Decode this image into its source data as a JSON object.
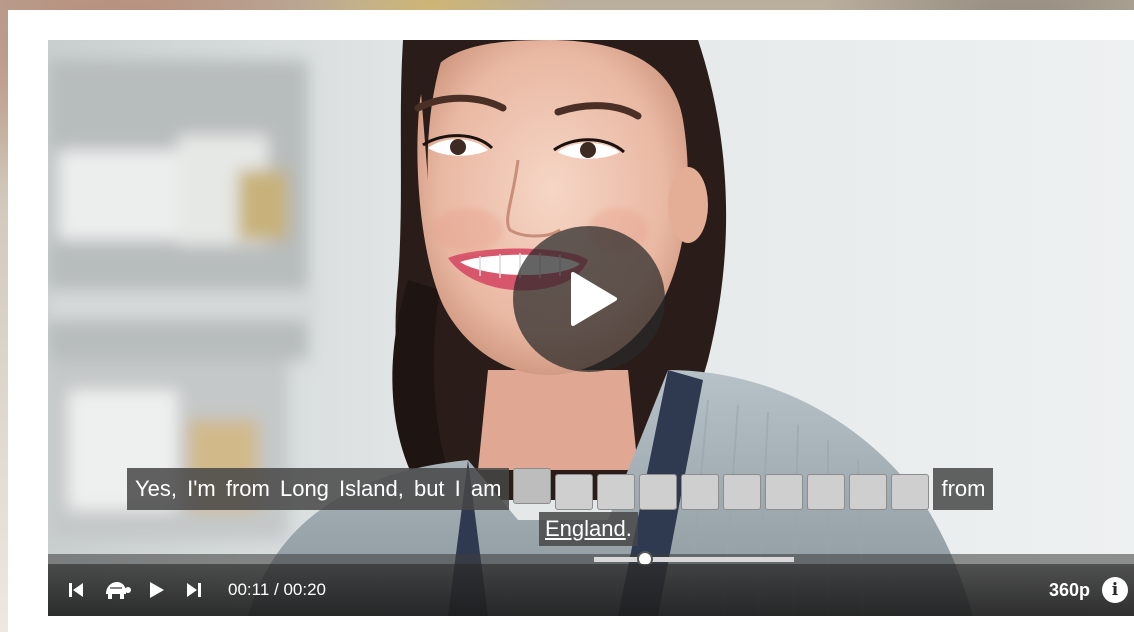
{
  "player": {
    "subtitle": {
      "before_blank": "Yes, I'm from Long Island, but I am",
      "blank_count": 10,
      "after_blank": "from",
      "link_word": "England",
      "end_punct": "."
    },
    "time": {
      "current": "00:11",
      "separator": " / ",
      "total": "00:20"
    },
    "progress_fraction": 0.55,
    "quality_label": "360p",
    "info_glyph": "i",
    "controls": {
      "previous_icon": "skip-previous-icon",
      "slow_icon": "turtle-slow-speed-icon",
      "play_icon": "play-icon",
      "next_icon": "skip-next-icon"
    },
    "colors": {
      "bar": "#2d2d2d",
      "subtitle_bg": "#464646",
      "blank_bg": "#cfcfcf"
    }
  }
}
